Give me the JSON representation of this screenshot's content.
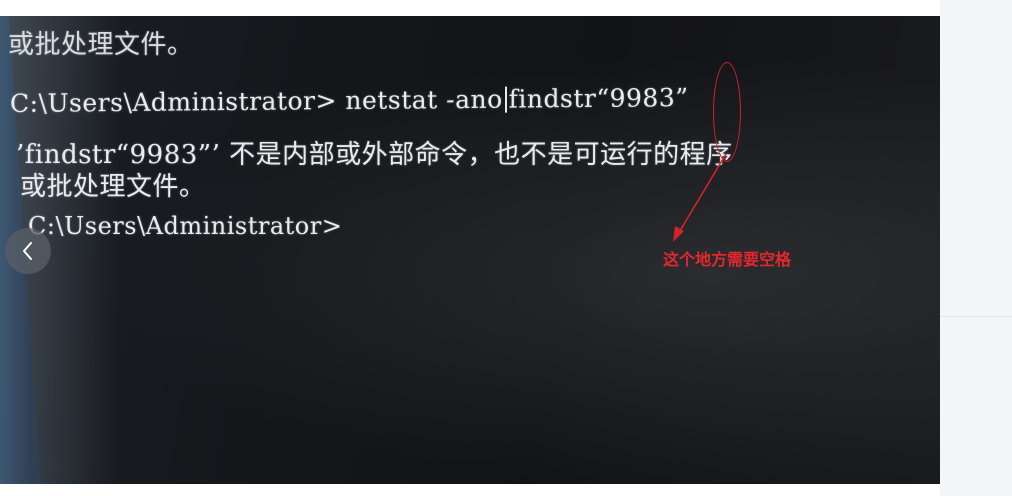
{
  "terminal": {
    "line_top": "或批处理文件。",
    "cmd_prompt": "C:\\Users\\Administrator>",
    "cmd_part1": " netstat -ano",
    "cmd_part2": "findstr“9983”",
    "error_line1": "’findstr“9983”’ 不是内部或外部命令，也不是可运行的程序",
    "error_line2": "或批处理文件。",
    "prompt_line": "C:\\Users\\Administrator>"
  },
  "annotation": {
    "label": "这个地方需要空格",
    "color": "#e0282e"
  },
  "viewer": {
    "prev_icon": "chevron-left-icon"
  }
}
